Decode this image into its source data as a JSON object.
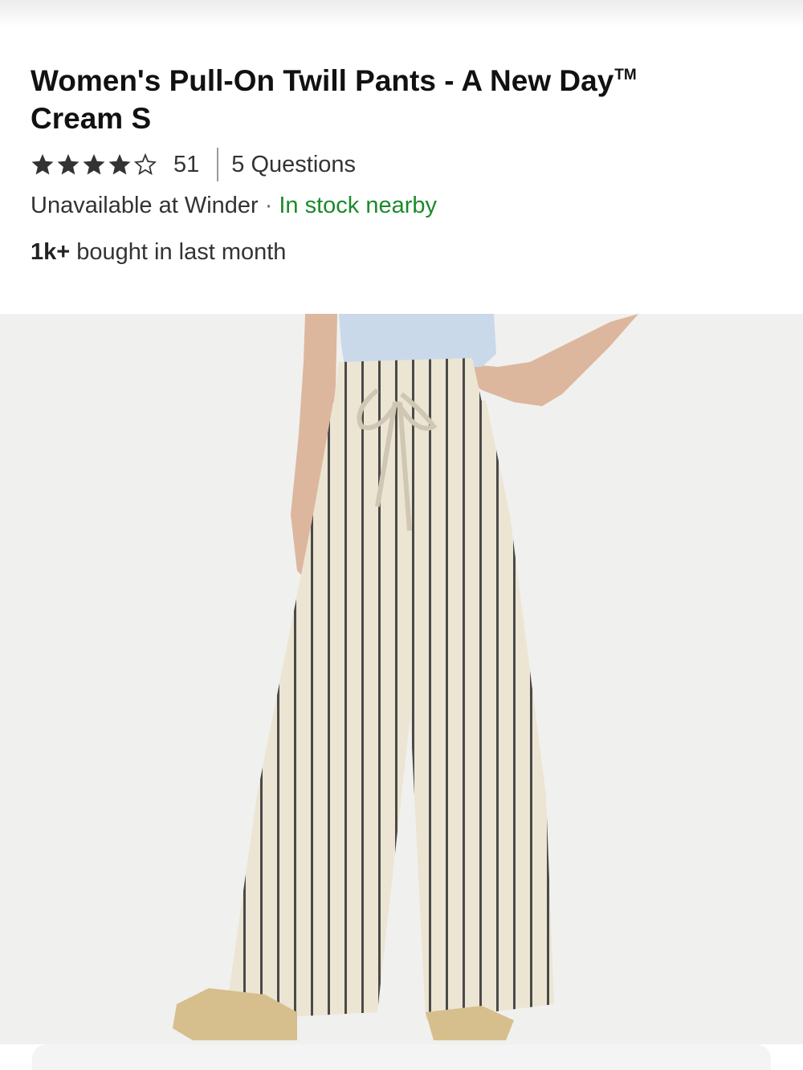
{
  "product": {
    "title": "Women's Pull-On Twill Pants - A New Day",
    "trademark": "TM",
    "variant": "Cream S"
  },
  "rating": {
    "value": 4,
    "max": 5,
    "review_count": "51",
    "questions": "5 Questions"
  },
  "availability": {
    "store_status": "Unavailable at Winder",
    "separator": "·",
    "nearby_status": "In stock nearby"
  },
  "social_proof": {
    "count": "1k+",
    "text": "bought in last month"
  },
  "colors": {
    "in_stock": "#1b8a2b",
    "star_fill": "#333333"
  }
}
